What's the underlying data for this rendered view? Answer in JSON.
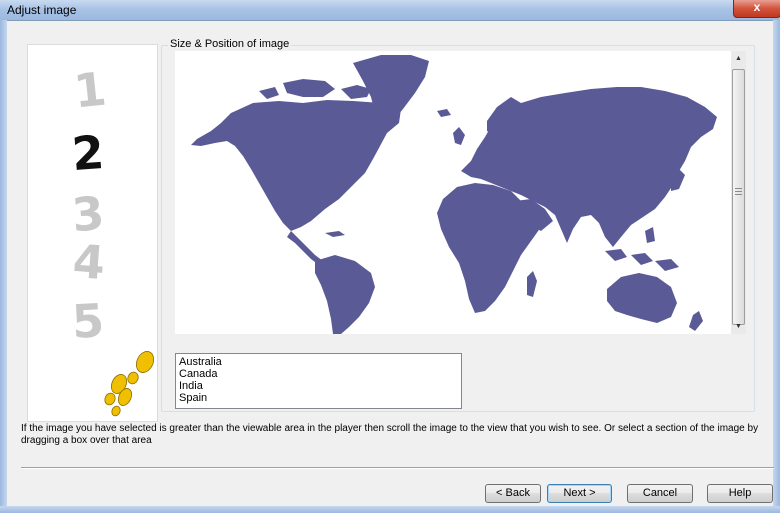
{
  "window": {
    "title": "Adjust image",
    "close_glyph": "x"
  },
  "steps": {
    "numbers": [
      "1",
      "2",
      "3",
      "4",
      "5"
    ],
    "current": "2",
    "active_color": "#111111",
    "inactive_color": "#c8c8c8",
    "footprints_icon": "footprints-icon",
    "footprints_color": "#f0c000"
  },
  "group": {
    "label": "Size & Position of image"
  },
  "image": {
    "content": "world-map",
    "land_color": "#5a5a96"
  },
  "scrollbar": {
    "up_glyph": "▲",
    "down_glyph": "▼"
  },
  "list": {
    "items": [
      "Australia",
      "Canada",
      "India",
      "Spain"
    ]
  },
  "hint": "If the image you have selected is greater than the viewable area in the player then scroll the image to the view that you wish to see. Or select a section of the image by dragging a box over that area",
  "buttons": {
    "back": "< Back",
    "next": "Next >",
    "cancel": "Cancel",
    "help": "Help"
  }
}
